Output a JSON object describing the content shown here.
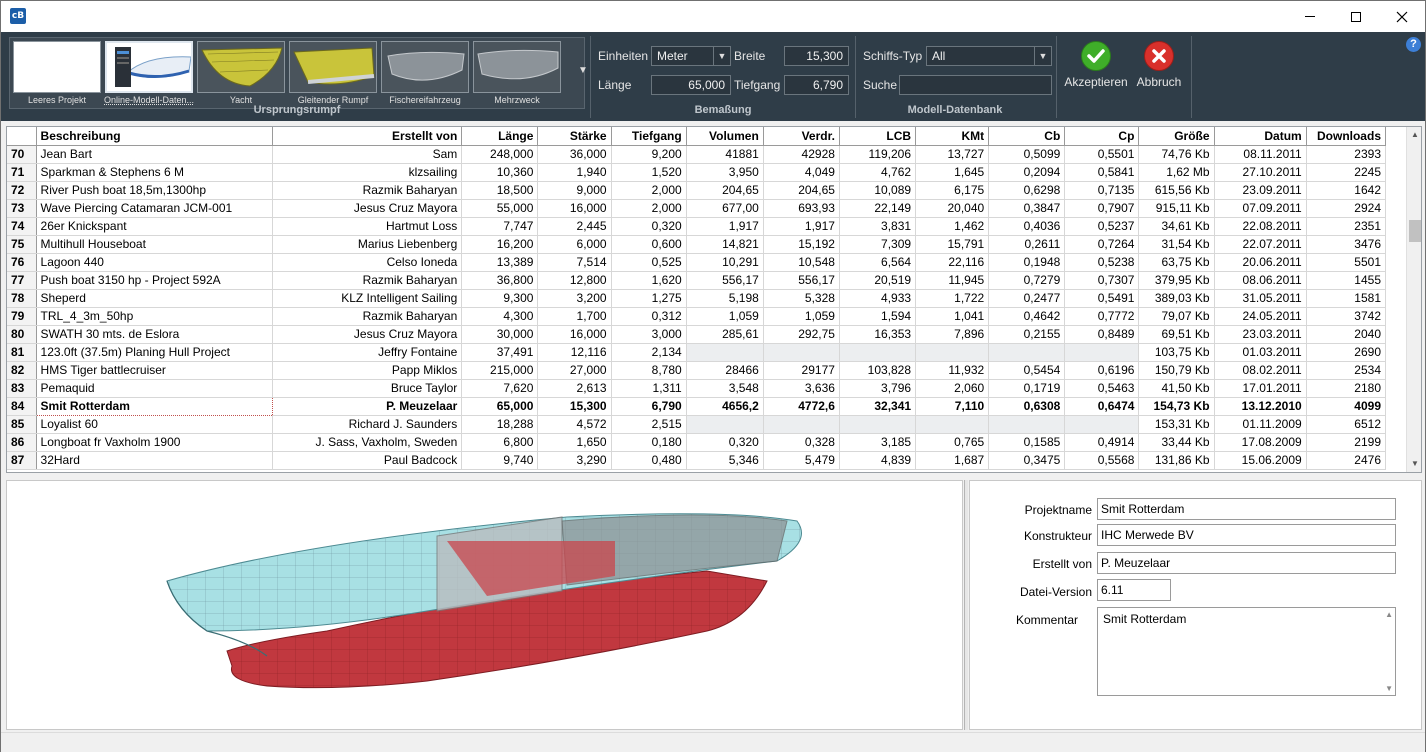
{
  "window": {
    "logo_text": "cB"
  },
  "ribbon": {
    "thumbnails": [
      {
        "caption": "Leeres Projekt",
        "kind": "blank"
      },
      {
        "caption": "Online-Modell-Daten...",
        "kind": "online",
        "selected": true
      },
      {
        "caption": "Yacht",
        "kind": "yacht"
      },
      {
        "caption": "Gleitender Rumpf",
        "kind": "planing"
      },
      {
        "caption": "Fischereifahrzeug",
        "kind": "fishing"
      },
      {
        "caption": "Mehrzweck",
        "kind": "multi"
      }
    ],
    "group_ursprungsrumpf": "Ursprungsrumpf",
    "einheiten_label": "Einheiten",
    "einheiten_value": "Meter",
    "breite_label": "Breite",
    "breite_value": "15,300",
    "laenge_label": "Länge",
    "laenge_value": "65,000",
    "tiefgang_label": "Tiefgang",
    "tiefgang_value": "6,790",
    "group_bemassung": "Bemaßung",
    "schiffstyp_label": "Schiffs-Typ",
    "schiffstyp_value": "All",
    "suche_label": "Suche",
    "suche_value": "",
    "group_modell": "Modell-Datenbank",
    "accept_label": "Akzeptieren",
    "cancel_label": "Abbruch",
    "accept_color": "#3fae29",
    "cancel_color": "#d9302b"
  },
  "table": {
    "headers": [
      "",
      "Beschreibung",
      "Erstellt von",
      "Länge",
      "Stärke",
      "Tiefgang",
      "Volumen",
      "Verdr.",
      "LCB",
      "KMt",
      "Cb",
      "Cp",
      "Größe",
      "Datum",
      "Downloads"
    ],
    "rows": [
      [
        "70",
        "Jean Bart",
        "Sam",
        "248,000",
        "36,000",
        "9,200",
        "41881",
        "42928",
        "119,206",
        "13,727",
        "0,5099",
        "0,5501",
        "74,76 Kb",
        "08.11.2011",
        "2393"
      ],
      [
        "71",
        "Sparkman & Stephens 6 M",
        "klzsailing",
        "10,360",
        "1,940",
        "1,520",
        "3,950",
        "4,049",
        "4,762",
        "1,645",
        "0,2094",
        "0,5841",
        "1,62 Mb",
        "27.10.2011",
        "2245"
      ],
      [
        "72",
        "River Push boat 18,5m,1300hp",
        "Razmik Baharyan",
        "18,500",
        "9,000",
        "2,000",
        "204,65",
        "204,65",
        "10,089",
        "6,175",
        "0,6298",
        "0,7135",
        "615,56 Kb",
        "23.09.2011",
        "1642"
      ],
      [
        "73",
        "Wave Piercing Catamaran JCM-001",
        "Jesus Cruz Mayora",
        "55,000",
        "16,000",
        "2,000",
        "677,00",
        "693,93",
        "22,149",
        "20,040",
        "0,3847",
        "0,7907",
        "915,11 Kb",
        "07.09.2011",
        "2924"
      ],
      [
        "74",
        "26er Knickspant",
        "Hartmut Loss",
        "7,747",
        "2,445",
        "0,320",
        "1,917",
        "1,917",
        "3,831",
        "1,462",
        "0,4036",
        "0,5237",
        "34,61 Kb",
        "22.08.2011",
        "2351"
      ],
      [
        "75",
        "Multihull Houseboat",
        "Marius Liebenberg",
        "16,200",
        "6,000",
        "0,600",
        "14,821",
        "15,192",
        "7,309",
        "15,791",
        "0,2611",
        "0,7264",
        "31,54 Kb",
        "22.07.2011",
        "3476"
      ],
      [
        "76",
        "Lagoon 440",
        "Celso Ioneda",
        "13,389",
        "7,514",
        "0,525",
        "10,291",
        "10,548",
        "6,564",
        "22,116",
        "0,1948",
        "0,5238",
        "63,75 Kb",
        "20.06.2011",
        "5501"
      ],
      [
        "77",
        "Push boat 3150 hp - Project 592A",
        "Razmik Baharyan",
        "36,800",
        "12,800",
        "1,620",
        "556,17",
        "556,17",
        "20,519",
        "11,945",
        "0,7279",
        "0,7307",
        "379,95 Kb",
        "08.06.2011",
        "1455"
      ],
      [
        "78",
        "Sheperd",
        "KLZ Intelligent Sailing",
        "9,300",
        "3,200",
        "1,275",
        "5,198",
        "5,328",
        "4,933",
        "1,722",
        "0,2477",
        "0,5491",
        "389,03 Kb",
        "31.05.2011",
        "1581"
      ],
      [
        "79",
        "TRL_4_3m_50hp",
        "Razmik Baharyan",
        "4,300",
        "1,700",
        "0,312",
        "1,059",
        "1,059",
        "1,594",
        "1,041",
        "0,4642",
        "0,7772",
        "79,07 Kb",
        "24.05.2011",
        "3742"
      ],
      [
        "80",
        "SWATH 30 mts. de Eslora",
        "Jesus Cruz Mayora",
        "30,000",
        "16,000",
        "3,000",
        "285,61",
        "292,75",
        "16,353",
        "7,896",
        "0,2155",
        "0,8489",
        "69,51 Kb",
        "23.03.2011",
        "2040"
      ],
      [
        "81",
        "123.0ft (37.5m) Planing Hull Project",
        "Jeffry Fontaine",
        "37,491",
        "12,116",
        "2,134",
        "",
        "",
        "",
        "",
        "",
        "",
        "103,75 Kb",
        "01.03.2011",
        "2690"
      ],
      [
        "82",
        "HMS Tiger battlecruiser",
        "Papp Miklos",
        "215,000",
        "27,000",
        "8,780",
        "28466",
        "29177",
        "103,828",
        "11,932",
        "0,5454",
        "0,6196",
        "150,79 Kb",
        "08.02.2011",
        "2534"
      ],
      [
        "83",
        "Pemaquid",
        "Bruce Taylor",
        "7,620",
        "2,613",
        "1,311",
        "3,548",
        "3,636",
        "3,796",
        "2,060",
        "0,1719",
        "0,5463",
        "41,50 Kb",
        "17.01.2011",
        "2180"
      ],
      [
        "84",
        "Smit Rotterdam",
        "P. Meuzelaar",
        "65,000",
        "15,300",
        "6,790",
        "4656,2",
        "4772,6",
        "32,341",
        "7,110",
        "0,6308",
        "0,6474",
        "154,73 Kb",
        "13.12.2010",
        "4099"
      ],
      [
        "85",
        "Loyalist 60",
        "Richard J. Saunders",
        "18,288",
        "4,572",
        "2,515",
        "",
        "",
        "",
        "",
        "",
        "",
        "153,31 Kb",
        "01.11.2009",
        "6512"
      ],
      [
        "86",
        "Longboat fr Vaxholm 1900",
        "J. Sass, Vaxholm, Sweden",
        "6,800",
        "1,650",
        "0,180",
        "0,320",
        "0,328",
        "3,185",
        "0,765",
        "0,1585",
        "0,4914",
        "33,44 Kb",
        "17.08.2009",
        "2199"
      ],
      [
        "87",
        "32Hard",
        "Paul Badcock",
        "9,740",
        "3,290",
        "0,480",
        "5,346",
        "5,479",
        "4,839",
        "1,687",
        "0,3475",
        "0,5568",
        "131,86 Kb",
        "15.06.2009",
        "2476"
      ]
    ],
    "selected_row": "84"
  },
  "properties": {
    "projektname_label": "Projektname",
    "projektname_value": "Smit Rotterdam",
    "konstrukteur_label": "Konstrukteur",
    "konstrukteur_value": "IHC Merwede BV",
    "erstellt_label": "Erstellt von",
    "erstellt_value": "P. Meuzelaar",
    "version_label": "Datei-Version",
    "version_value": "6.11",
    "kommentar_label": "Kommentar",
    "kommentar_value": "Smit Rotterdam"
  }
}
